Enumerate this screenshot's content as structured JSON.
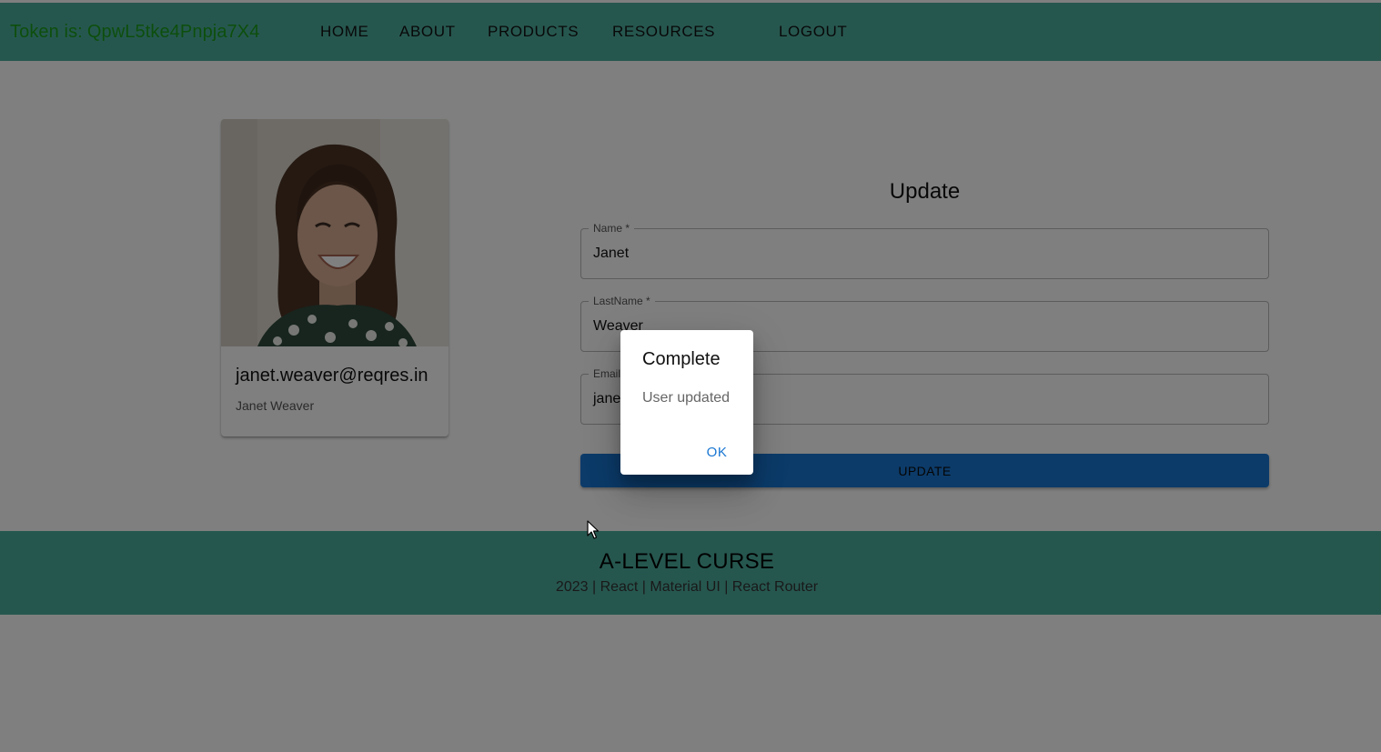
{
  "navbar": {
    "token_label": "Token is:",
    "token_value": "QpwL5tke4Pnpja7X4",
    "links": [
      "HOME",
      "ABOUT",
      "PRODUCTS",
      "RESOURCES",
      "LOGOUT"
    ]
  },
  "profile_card": {
    "photo_icon": "user-photo",
    "email": "janet.weaver@reqres.in",
    "full_name": "Janet Weaver"
  },
  "form": {
    "title": "Update",
    "name_label": "Name *",
    "name_value": "Janet",
    "lastname_label": "LastName *",
    "lastname_value": "Weaver",
    "email_label": "Email",
    "email_value": "jane",
    "submit_label": "UPDATE"
  },
  "dialog": {
    "title": "Complete",
    "message": "User updated",
    "ok_label": "OK"
  },
  "footer": {
    "title": "A-LEVEL CURSE",
    "subtitle": "2023 | React | Material UI | React Router"
  },
  "colors": {
    "header_footer": "#4caf9f",
    "token_text": "#1b9e1b",
    "primary": "#1976d2"
  }
}
